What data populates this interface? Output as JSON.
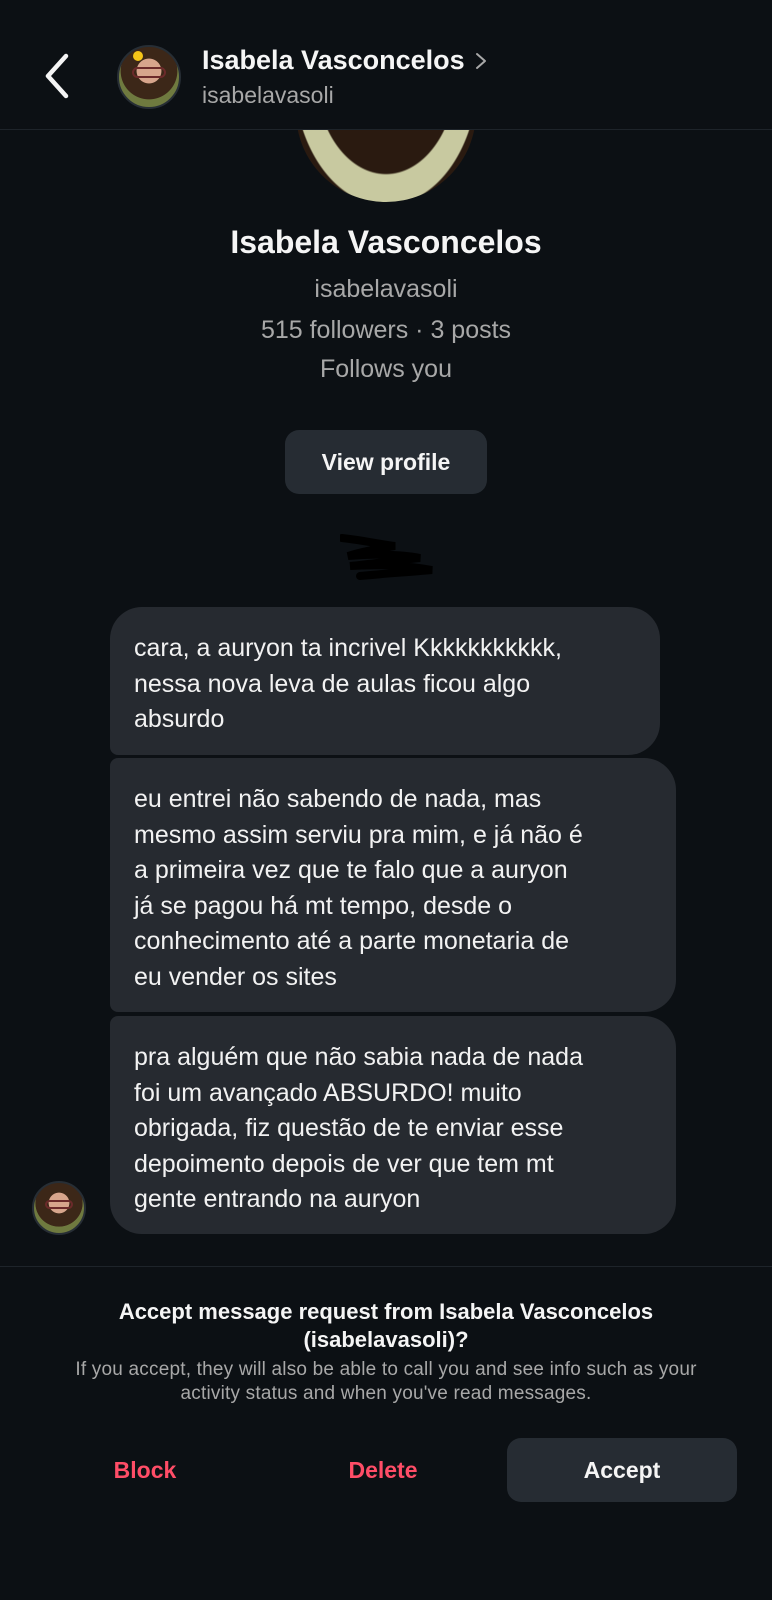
{
  "header": {
    "name": "Isabela Vasconcelos",
    "username": "isabelavasoli"
  },
  "profile": {
    "name": "Isabela Vasconcelos",
    "username": "isabelavasoli",
    "stats": "515 followers · 3 posts",
    "follows": "Follows you",
    "view_profile_label": "View profile"
  },
  "messages": [
    {
      "lines": [
        "cara, a auryon ta incrivel Kkkkkkkkkkk,",
        "nessa nova leva de aulas ficou algo",
        "absurdo"
      ]
    },
    {
      "lines": [
        "eu entrei não sabendo de nada, mas",
        "mesmo assim serviu pra mim, e já não é",
        "a primeira vez que te falo que a auryon",
        "já se pagou há mt tempo, desde o",
        "conhecimento até a parte monetaria de",
        "eu vender os sites"
      ]
    },
    {
      "lines": [
        "pra alguém que não sabia nada de nada",
        "foi um avançado ABSURDO! muito",
        "obrigada, fiz questão de te enviar esse",
        "depoimento depois de ver que tem mt",
        "gente entrando na auryon"
      ]
    }
  ],
  "request": {
    "title_line1": "Accept message request from Isabela Vasconcelos",
    "title_line2": "(isabelavasoli)?",
    "desc_line1": "If you accept, they will also be able to call you and see info such as your",
    "desc_line2": "activity status and when you've read messages.",
    "block_label": "Block",
    "delete_label": "Delete",
    "accept_label": "Accept"
  },
  "colors": {
    "background": "#0c1014",
    "bubble": "#262a30",
    "destructive": "#ff4d67",
    "muted_text": "#a8a8a8"
  },
  "icons": {
    "back": "chevron-left-icon",
    "header_chevron": "chevron-right-icon"
  }
}
